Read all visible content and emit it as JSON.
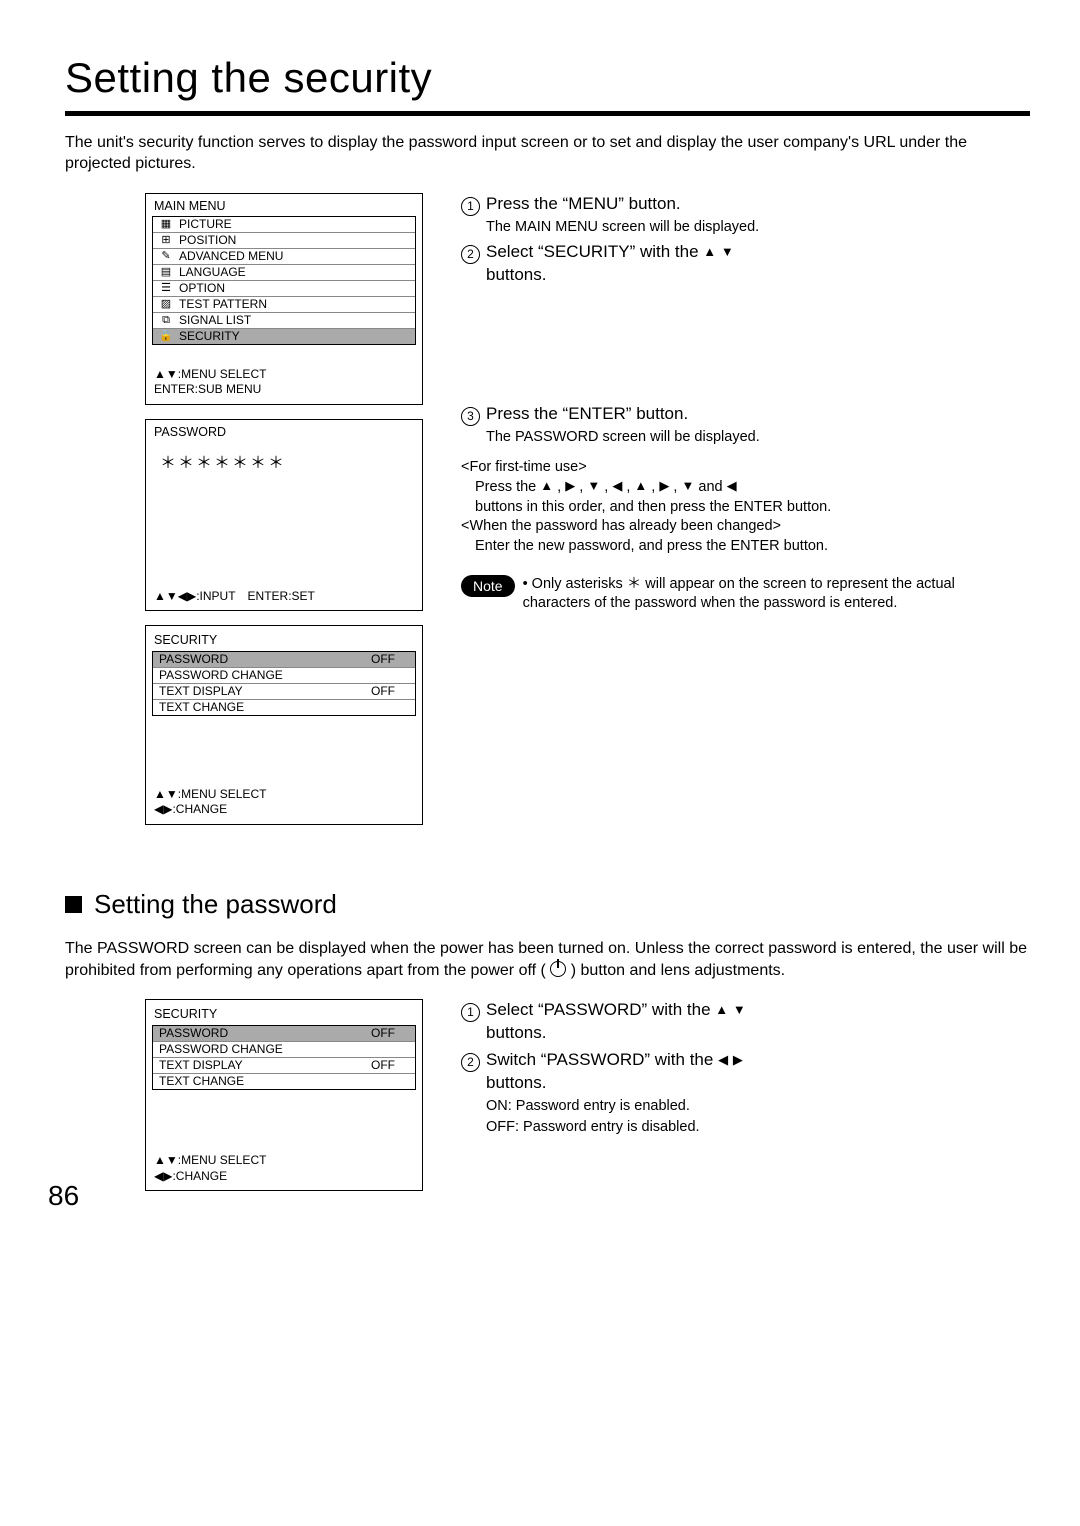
{
  "title": "Setting the security",
  "intro": "The unit's security function serves to display the password input screen or to set and display the user company's URL under the projected pictures.",
  "main_menu": {
    "heading": "MAIN MENU",
    "items": [
      {
        "icon": "▦",
        "label": "PICTURE"
      },
      {
        "icon": "⊞",
        "label": "POSITION"
      },
      {
        "icon": "✎",
        "label": "ADVANCED MENU"
      },
      {
        "icon": "▤",
        "label": "LANGUAGE"
      },
      {
        "icon": "☰",
        "label": "OPTION"
      },
      {
        "icon": "▨",
        "label": "TEST PATTERN"
      },
      {
        "icon": "⧉",
        "label": "SIGNAL LIST"
      },
      {
        "icon": "🔒",
        "label": "SECURITY"
      }
    ],
    "highlight_index": 7,
    "footer1": "▲▼:MENU SELECT",
    "footer2": "ENTER:SUB MENU"
  },
  "password_screen": {
    "heading": "PASSWORD",
    "stars": "＊＊＊＊＊＊＊",
    "footer": "▲▼◀▶:INPUT ENTER:SET"
  },
  "security_menu1": {
    "heading": "SECURITY",
    "rows": [
      {
        "label": "PASSWORD",
        "val": "OFF",
        "shaded": true
      },
      {
        "label": "PASSWORD CHANGE",
        "val": ""
      },
      {
        "label": "TEXT DISPLAY",
        "val": "OFF"
      },
      {
        "label": "TEXT CHANGE",
        "val": ""
      }
    ],
    "footer1": "▲▼:MENU SELECT",
    "footer2": "◀▶:CHANGE"
  },
  "steps_a": {
    "s1_main": "Press the “MENU” button.",
    "s1_sub": "The MAIN MENU screen will be displayed.",
    "s2_main_a": "Select “SECURITY” with the ",
    "s2_main_b": " buttons.",
    "s3_main": "Press the “ENTER” button.",
    "s3_sub": "The PASSWORD screen will be displayed."
  },
  "first_time": {
    "h": "<For first-time use>",
    "l1a": "Press the  ",
    "l1b": "  and  ",
    "l2": "buttons in this order, and then press the  ENTER button.",
    "h2": "<When the password has already been changed>",
    "l3": "Enter the new password, and press the  ENTER button."
  },
  "note": {
    "label": "Note",
    "text": "• Only asterisks ＊ will appear on the screen to represent the actual characters of the password when the password is entered."
  },
  "section2_h": "Setting the password",
  "section2_intro_a": "The PASSWORD screen can be displayed when the power has been turned on. Unless the correct password is entered, the user will be prohibited from performing any operations apart from the power off (",
  "section2_intro_b": ") button and lens adjustments.",
  "security_menu2": {
    "heading": "SECURITY",
    "rows": [
      {
        "label": "PASSWORD",
        "val": "OFF",
        "shaded": true
      },
      {
        "label": "PASSWORD CHANGE",
        "val": ""
      },
      {
        "label": "TEXT DISPLAY",
        "val": "OFF"
      },
      {
        "label": "TEXT CHANGE",
        "val": ""
      }
    ],
    "footer1": "▲▼:MENU SELECT",
    "footer2": "◀▶:CHANGE"
  },
  "steps_b": {
    "s1_main_a": "Select “PASSWORD” with the ",
    "s1_main_b": " buttons.",
    "s2_main_a": "Switch “PASSWORD” with the ",
    "s2_main_b": " buttons.",
    "s2_sub1": "ON: Password entry is enabled.",
    "s2_sub2": "OFF: Password entry is disabled."
  },
  "page_num": "86"
}
